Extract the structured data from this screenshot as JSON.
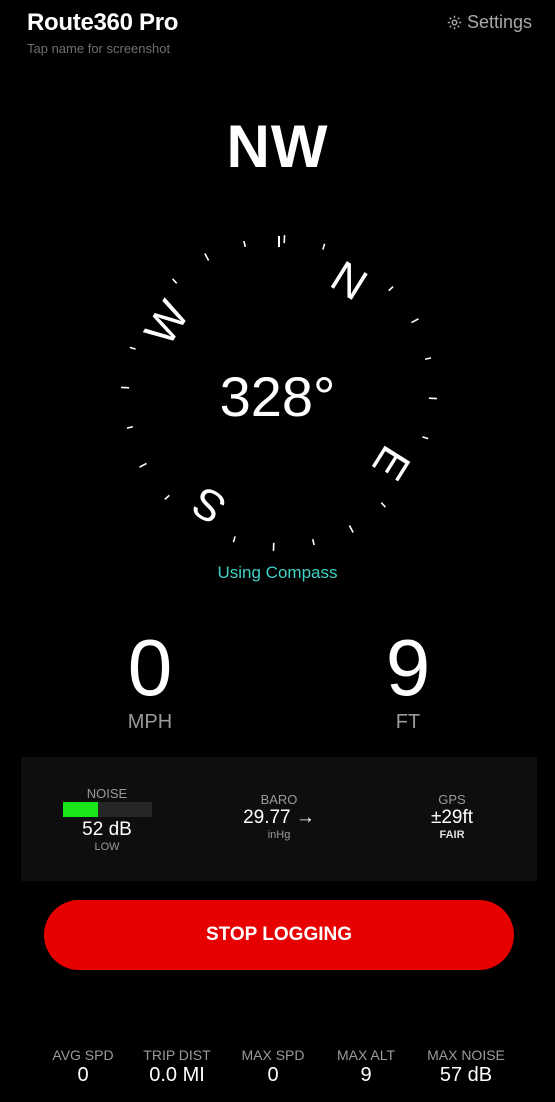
{
  "header": {
    "title": "Route360 Pro",
    "hint": "Tap name for screenshot",
    "settings_label": "Settings",
    "settings_icon": "gear-icon"
  },
  "compass": {
    "heading_label": "NW",
    "degrees": "328°",
    "heading_deg": 328,
    "source": "Using Compass",
    "cardinals": [
      "N",
      "E",
      "S",
      "W"
    ]
  },
  "speed": {
    "value": "0",
    "unit": "MPH"
  },
  "altitude": {
    "value": "9",
    "unit": "FT"
  },
  "stats": {
    "noise": {
      "label": "NOISE",
      "value": "52 dB",
      "sub": "LOW",
      "level": 0.4,
      "color": "#19e51b"
    },
    "baro": {
      "label": "BARO",
      "value": "29.77 →",
      "sub": "inHg"
    },
    "gps": {
      "label": "GPS",
      "value": "±29ft",
      "sub": "FAIR"
    }
  },
  "stop_button_label": "STOP LOGGING",
  "trip": [
    {
      "label": "AVG SPD",
      "value": "0"
    },
    {
      "label": "TRIP DIST",
      "value": "0.0 MI"
    },
    {
      "label": "MAX SPD",
      "value": "0"
    },
    {
      "label": "MAX ALT",
      "value": "9"
    },
    {
      "label": "MAX NOISE",
      "value": "57 dB"
    }
  ],
  "colors": {
    "accent_teal": "#3fd0c4",
    "stop_red": "#e60000",
    "noise_green": "#19e51b"
  }
}
